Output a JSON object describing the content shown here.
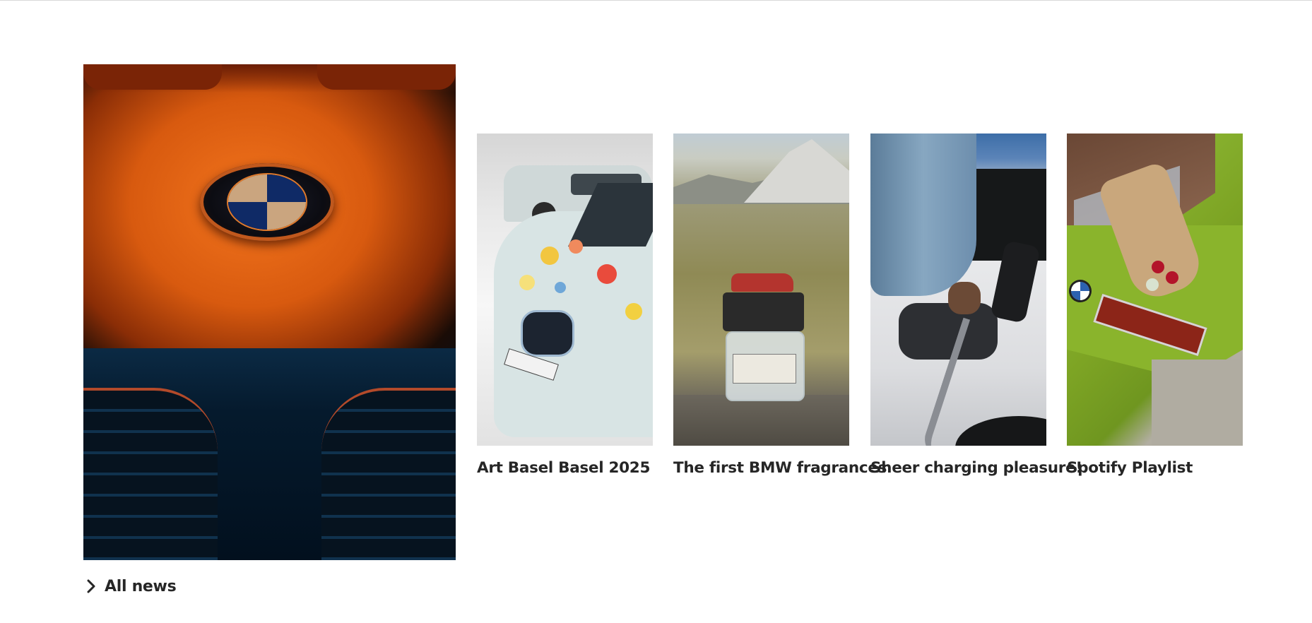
{
  "hero": {
    "image_icon": "bmw-hood-logo-image"
  },
  "news": {
    "items": [
      {
        "title": "Art Basel Basel 2025",
        "image_icon": "art-car-image"
      },
      {
        "title": "The first BMW fragrances",
        "image_icon": "fragrance-bottle-image"
      },
      {
        "title": "Sheer charging pleasure!",
        "image_icon": "ev-charging-image"
      },
      {
        "title": "Spotify Playlist",
        "image_icon": "green-car-bouquet-image"
      }
    ],
    "all_news_label": "All news",
    "all_news_icon": "chevron-right-icon"
  },
  "colors": {
    "text": "#262626",
    "background": "#ffffff",
    "divider": "#d9d9d9"
  }
}
